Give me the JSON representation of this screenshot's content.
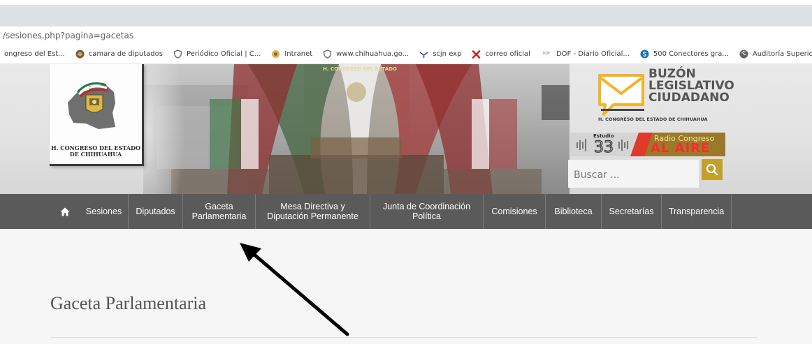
{
  "browser": {
    "url_text": "/sesiones.php?pagina=gacetas",
    "bookmarks": [
      {
        "label": "ongreso del Est...",
        "icon": "site-icon"
      },
      {
        "label": "camara de diputados",
        "icon": "chamber-icon"
      },
      {
        "label": "Periódico Oficial | C...",
        "icon": "shield-icon"
      },
      {
        "label": "Intranet",
        "icon": "intranet-icon"
      },
      {
        "label": "www.chihuahua.go...",
        "icon": "shield-icon"
      },
      {
        "label": "scjn exp",
        "icon": "scjn-icon"
      },
      {
        "label": "correo oficial",
        "icon": "x-mark-icon"
      },
      {
        "label": "DOF - Diario Oficial...",
        "icon": "dof-icon"
      },
      {
        "label": "500 Conectores gra...",
        "icon": "s-circle-icon"
      },
      {
        "label": "Auditoría Superior...",
        "icon": "globe-icon"
      }
    ],
    "dof_icon_text": "DOF"
  },
  "header": {
    "logo_text_line1": "H. CONGRESO DEL ESTADO",
    "logo_text_line2": "DE CHIHUAHUA",
    "hall_banner_text": "H. CONGRESO DEL ESTADO",
    "buzon_line1": "BUZÓN",
    "buzon_line2": "LEGISLATIVO",
    "buzon_line3": "CIUDADANO",
    "buzon_subtitle": "H. CONGRESO DEL ESTADO DE CHIHUAHUA",
    "radio_studio": "Estudio",
    "radio_studio_number": "33",
    "radio_line1": "Radio Congreso",
    "radio_line2": "AL AIRE",
    "search_placeholder": "Buscar ..."
  },
  "nav": {
    "home_icon": "home-icon",
    "items": [
      {
        "line1": "Sesiones",
        "line2": ""
      },
      {
        "line1": "Diputados",
        "line2": ""
      },
      {
        "line1": "Gaceta",
        "line2": "Parlamentaria"
      },
      {
        "line1": "Mesa Directiva y",
        "line2": "Diputación Permanente"
      },
      {
        "line1": "Junta de Coordinación",
        "line2": "Política"
      },
      {
        "line1": "Comisiones",
        "line2": ""
      },
      {
        "line1": "Biblioteca",
        "line2": ""
      },
      {
        "line1": "Secretarías",
        "line2": ""
      },
      {
        "line1": "Transparencia",
        "line2": ""
      }
    ]
  },
  "content": {
    "page_title": "Gaceta Parlamentaria"
  },
  "colors": {
    "nav_bg": "#5a5a5a",
    "accent_gold": "#c3a02c",
    "radio_red": "#ff2a2a"
  }
}
